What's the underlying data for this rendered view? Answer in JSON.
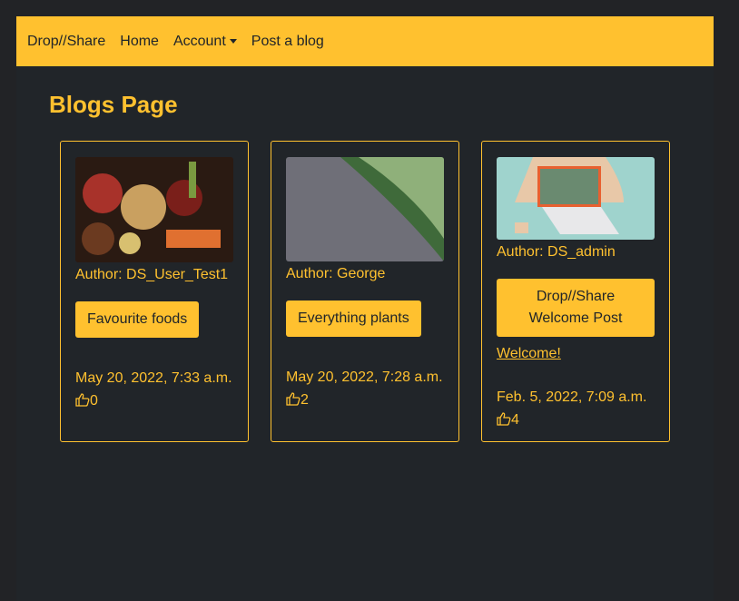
{
  "nav": {
    "brand": "Drop//Share",
    "home": "Home",
    "account": "Account",
    "post": "Post a blog"
  },
  "page_title": "Blogs Page",
  "cards": [
    {
      "author": "Author: DS_User_Test1",
      "title": "Favourite foods",
      "date": "May 20, 2022, 7:33 a.m.",
      "likes": "0",
      "image": "food"
    },
    {
      "author": "Author: George",
      "title": "Everything plants",
      "date": "May 20, 2022, 7:28 a.m.",
      "likes": "2",
      "image": "ivy"
    },
    {
      "author": "Author: DS_admin",
      "title": "Drop//Share Welcome Post",
      "link": "Welcome!",
      "date": "Feb. 5, 2022, 7:09 a.m.",
      "likes": "4",
      "image": "laptop"
    }
  ]
}
